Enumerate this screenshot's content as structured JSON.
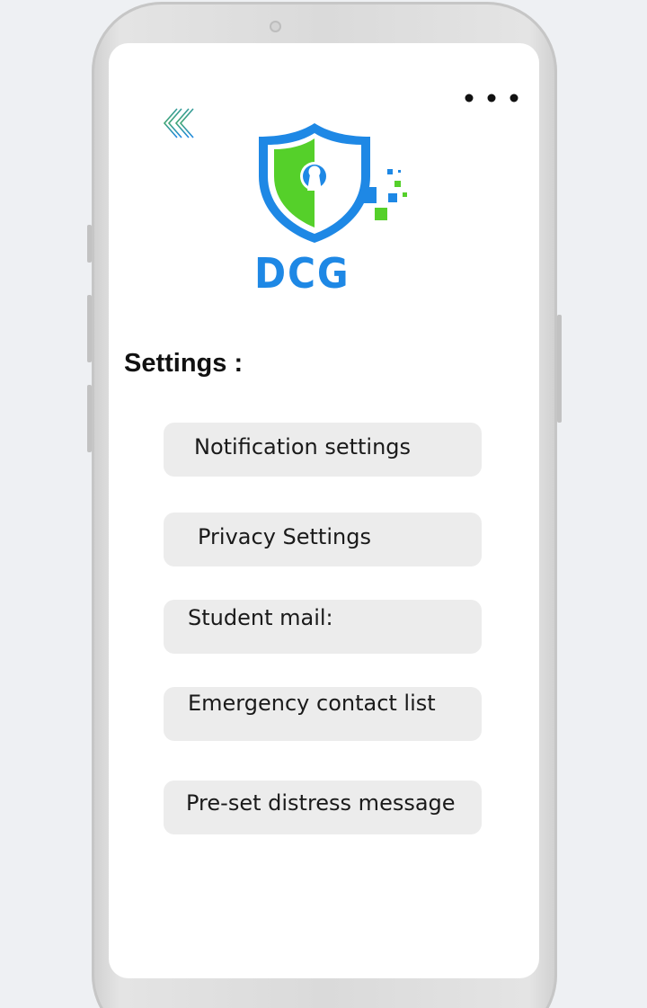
{
  "header": {
    "back_icon": "double-chevron-left-icon",
    "menu_icon": "more-horizontal-icon"
  },
  "logo": {
    "text": "DCG",
    "colors": {
      "blue": "#1e88e5",
      "green": "#55d02a"
    }
  },
  "settings": {
    "title": "Settings :",
    "items": [
      {
        "label": "Notification settings"
      },
      {
        "label": "Privacy Settings"
      },
      {
        "label": "Student mail:"
      },
      {
        "label": "Emergency contact list"
      },
      {
        "label": "Pre-set distress message"
      }
    ]
  }
}
